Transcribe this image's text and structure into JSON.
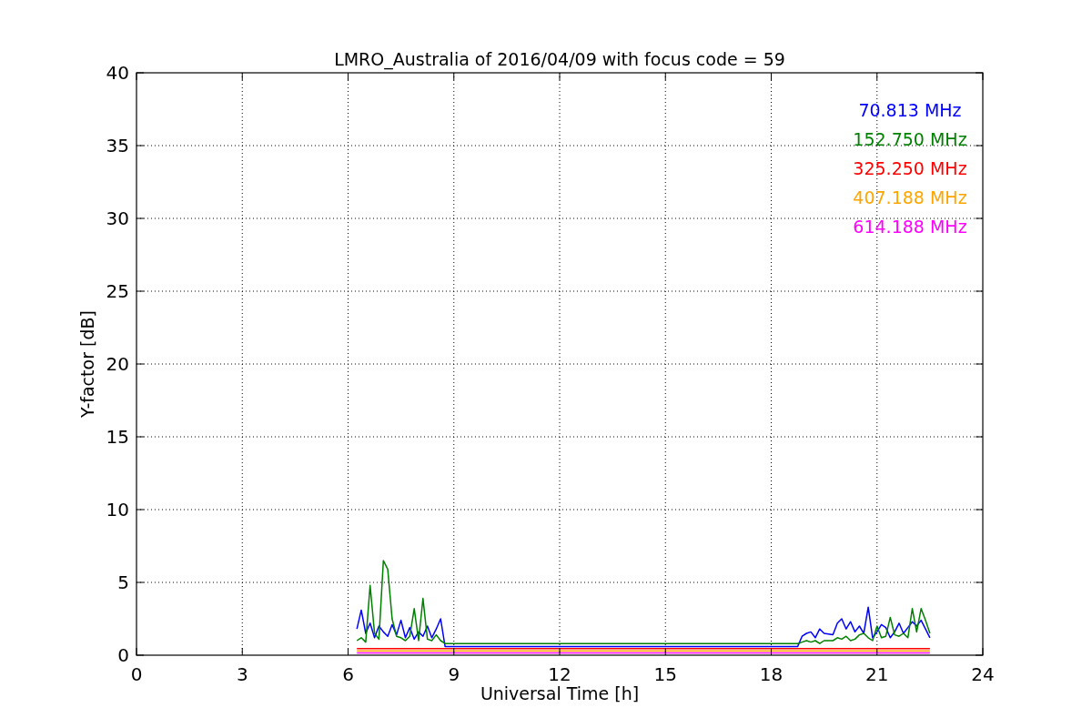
{
  "chart_data": {
    "type": "line",
    "title": "LMRO_Australia of 2016/04/09 with focus code = 59",
    "xlabel": "Universal Time [h]",
    "ylabel": "Y-factor [dB]",
    "x": [
      6.25,
      6.375,
      6.5,
      6.625,
      6.75,
      6.875,
      7,
      7.125,
      7.25,
      7.375,
      7.5,
      7.625,
      7.75,
      7.875,
      8,
      8.125,
      8.25,
      8.375,
      8.5,
      8.625,
      8.75,
      18.75,
      18.875,
      19,
      19.125,
      19.25,
      19.375,
      19.5,
      19.75,
      19.875,
      20,
      20.125,
      20.25,
      20.375,
      20.5,
      20.625,
      20.75,
      20.875,
      21,
      21.125,
      21.25,
      21.375,
      21.5,
      21.625,
      21.75,
      21.875,
      22,
      22.125,
      22.25,
      22.375,
      22.5
    ],
    "series": [
      {
        "name": "70.813 MHz",
        "color": "#0000ff",
        "values": [
          1.8,
          3.1,
          1.5,
          2.2,
          1.2,
          2.0,
          1.6,
          1.3,
          2.1,
          1.4,
          2.4,
          1.2,
          1.9,
          1.1,
          1.6,
          1.3,
          2.0,
          1.2,
          1.8,
          2.5,
          0.6,
          0.6,
          1.3,
          1.5,
          1.6,
          1.2,
          1.8,
          1.5,
          1.4,
          2.2,
          2.5,
          1.8,
          2.3,
          1.6,
          2.0,
          1.5,
          3.3,
          1.2,
          1.6,
          2.1,
          1.9,
          1.2,
          1.6,
          2.2,
          1.5,
          1.9,
          2.3,
          2.0,
          2.4,
          1.8,
          1.2
        ]
      },
      {
        "name": "152.750 MHz",
        "color": "#008000",
        "values": [
          1.0,
          1.2,
          0.9,
          4.8,
          1.5,
          1.1,
          6.5,
          5.9,
          2.5,
          1.3,
          1.2,
          1.0,
          1.3,
          3.2,
          1.0,
          3.9,
          1.1,
          1.0,
          1.4,
          1.0,
          0.8,
          0.8,
          0.9,
          1.0,
          0.9,
          1.0,
          0.8,
          1.0,
          1.0,
          1.2,
          1.1,
          1.3,
          1.0,
          1.1,
          1.4,
          1.5,
          1.2,
          1.0,
          2.0,
          1.2,
          1.3,
          2.6,
          1.4,
          1.3,
          1.5,
          1.2,
          3.2,
          1.6,
          3.2,
          2.4,
          1.5
        ]
      },
      {
        "name": "325.250 MHz",
        "color": "#ff0000",
        "values": [
          0.45,
          0.45,
          0.45,
          0.45,
          0.45,
          0.45,
          0.45,
          0.45,
          0.45,
          0.45,
          0.45,
          0.45,
          0.45,
          0.45,
          0.45,
          0.45,
          0.45,
          0.45,
          0.45,
          0.45,
          0.45,
          0.45,
          0.45,
          0.45,
          0.45,
          0.45,
          0.45,
          0.45,
          0.45,
          0.45,
          0.45,
          0.45,
          0.45,
          0.45,
          0.45,
          0.45,
          0.45,
          0.45,
          0.45,
          0.45,
          0.45,
          0.45,
          0.45,
          0.45,
          0.45,
          0.45,
          0.45,
          0.45,
          0.45,
          0.45,
          0.45
        ]
      },
      {
        "name": "407.188 MHz",
        "color": "#ffa500",
        "values": [
          0.3,
          0.3,
          0.3,
          0.3,
          0.3,
          0.3,
          0.3,
          0.3,
          0.3,
          0.3,
          0.3,
          0.3,
          0.3,
          0.3,
          0.3,
          0.3,
          0.3,
          0.3,
          0.3,
          0.3,
          0.3,
          0.3,
          0.3,
          0.3,
          0.3,
          0.3,
          0.3,
          0.3,
          0.3,
          0.3,
          0.3,
          0.3,
          0.3,
          0.3,
          0.3,
          0.3,
          0.3,
          0.3,
          0.3,
          0.3,
          0.3,
          0.3,
          0.3,
          0.3,
          0.3,
          0.3,
          0.3,
          0.3,
          0.3,
          0.3,
          0.3
        ]
      },
      {
        "name": "614.188 MHz",
        "color": "#ff00ff",
        "values": [
          0.15,
          0.15,
          0.15,
          0.15,
          0.15,
          0.15,
          0.15,
          0.15,
          0.15,
          0.15,
          0.15,
          0.15,
          0.15,
          0.15,
          0.15,
          0.15,
          0.15,
          0.15,
          0.15,
          0.15,
          0.15,
          0.15,
          0.15,
          0.15,
          0.15,
          0.15,
          0.15,
          0.15,
          0.15,
          0.15,
          0.15,
          0.15,
          0.15,
          0.15,
          0.15,
          0.15,
          0.15,
          0.15,
          0.15,
          0.15,
          0.15,
          0.15,
          0.15,
          0.15,
          0.15,
          0.15,
          0.15,
          0.15,
          0.15,
          0.15,
          0.15
        ]
      }
    ],
    "grid": true,
    "xlim": [
      0,
      24
    ],
    "ylim": [
      0,
      40
    ],
    "xticks": [
      0,
      3,
      6,
      9,
      12,
      15,
      18,
      21,
      24
    ],
    "yticks": [
      0,
      5,
      10,
      15,
      20,
      25,
      30,
      35,
      40
    ]
  }
}
